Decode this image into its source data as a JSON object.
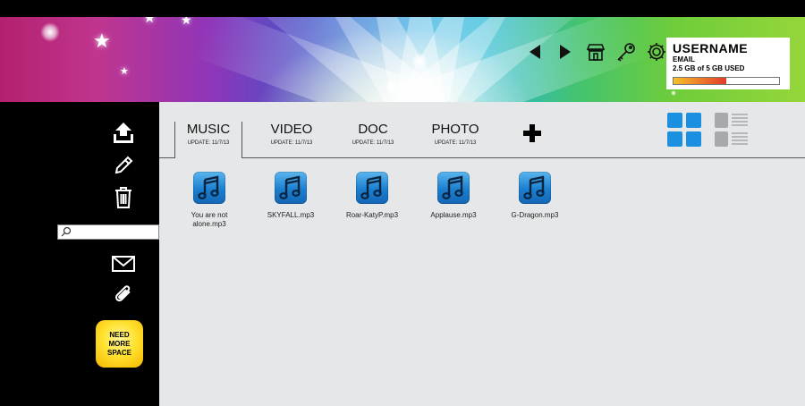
{
  "header": {
    "username": "USERNAME",
    "email": "EMAIL",
    "usage": "2.5 GB of 5 GB USED",
    "quota_used_fraction": 0.5
  },
  "nav_icons": [
    "back-arrow-icon",
    "forward-arrow-icon",
    "store-icon",
    "key-icon",
    "gear-icon"
  ],
  "sidebar": {
    "actions": [
      "upload-icon",
      "pencil-icon",
      "trash-icon"
    ],
    "search_placeholder": "",
    "bottom_actions": [
      "envelope-icon",
      "paperclip-icon"
    ],
    "promo": "NEED MORE SPACE"
  },
  "tabs": [
    {
      "label": "MUSIC",
      "date": "UPDATE: 11/7/13",
      "active": true
    },
    {
      "label": "VIDEO",
      "date": "UPDATE: 11/7/13",
      "active": false
    },
    {
      "label": "DOC",
      "date": "UPDATE: 11/7/13",
      "active": false
    },
    {
      "label": "PHOTO",
      "date": "UPDATE: 11/7/13",
      "active": false
    }
  ],
  "files": [
    {
      "name": "You are not alone.mp3"
    },
    {
      "name": "SKYFALL.mp3"
    },
    {
      "name": "Roar-KatyP.mp3"
    },
    {
      "name": "Applause.mp3"
    },
    {
      "name": "G-Dragon.mp3"
    }
  ],
  "colors": {
    "accent_blue": "#1b7fd0",
    "content_bg": "#e6e7e8",
    "sidebar_bg": "#000000",
    "promo_yellow": "#ffe230"
  }
}
